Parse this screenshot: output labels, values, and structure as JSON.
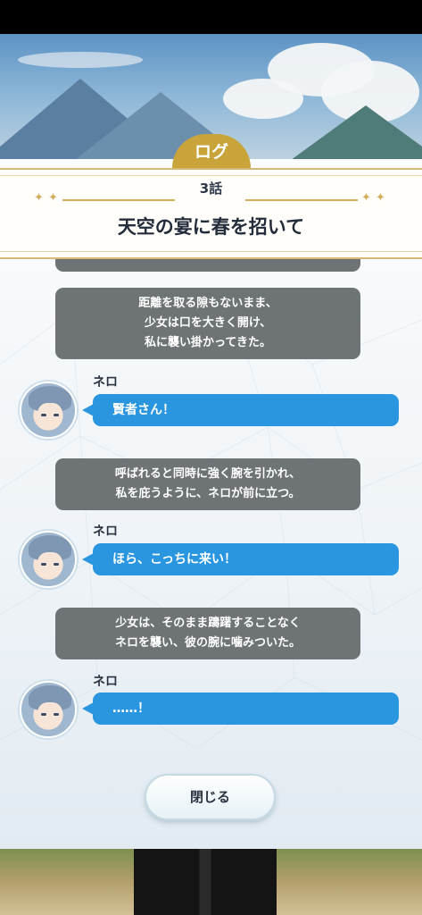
{
  "header": {
    "tab_label": "ログ",
    "episode": "3話",
    "chapter_title": "天空の宴に春を招いて"
  },
  "log": {
    "narration_1": {
      "line1": "距離を取る隙もないまま、",
      "line2": "少女は口を大きく開け、",
      "line3": "私に襲い掛かってきた。"
    },
    "dialogue_1": {
      "speaker": "ネロ",
      "text": "賢者さん！"
    },
    "narration_2": {
      "line1": "呼ばれると同時に強く腕を引かれ、",
      "line2": "私を庇うように、ネロが前に立つ。"
    },
    "dialogue_2": {
      "speaker": "ネロ",
      "text": "ほら、こっちに来い！"
    },
    "narration_3": {
      "line1": "少女は、そのまま躊躇することなく",
      "line2": "ネロを襲い、彼の腕に噛みついた。"
    },
    "dialogue_3": {
      "speaker": "ネロ",
      "text": "……！"
    }
  },
  "footer": {
    "close_label": "閉じる"
  },
  "icons": {
    "avatar": "nero-portrait-icon",
    "ornament": "star-ornament-icon"
  },
  "colors": {
    "accent_gold": "#c8a43a",
    "narration_bg": "#6e7375",
    "dialogue_bg": "#2996df"
  }
}
